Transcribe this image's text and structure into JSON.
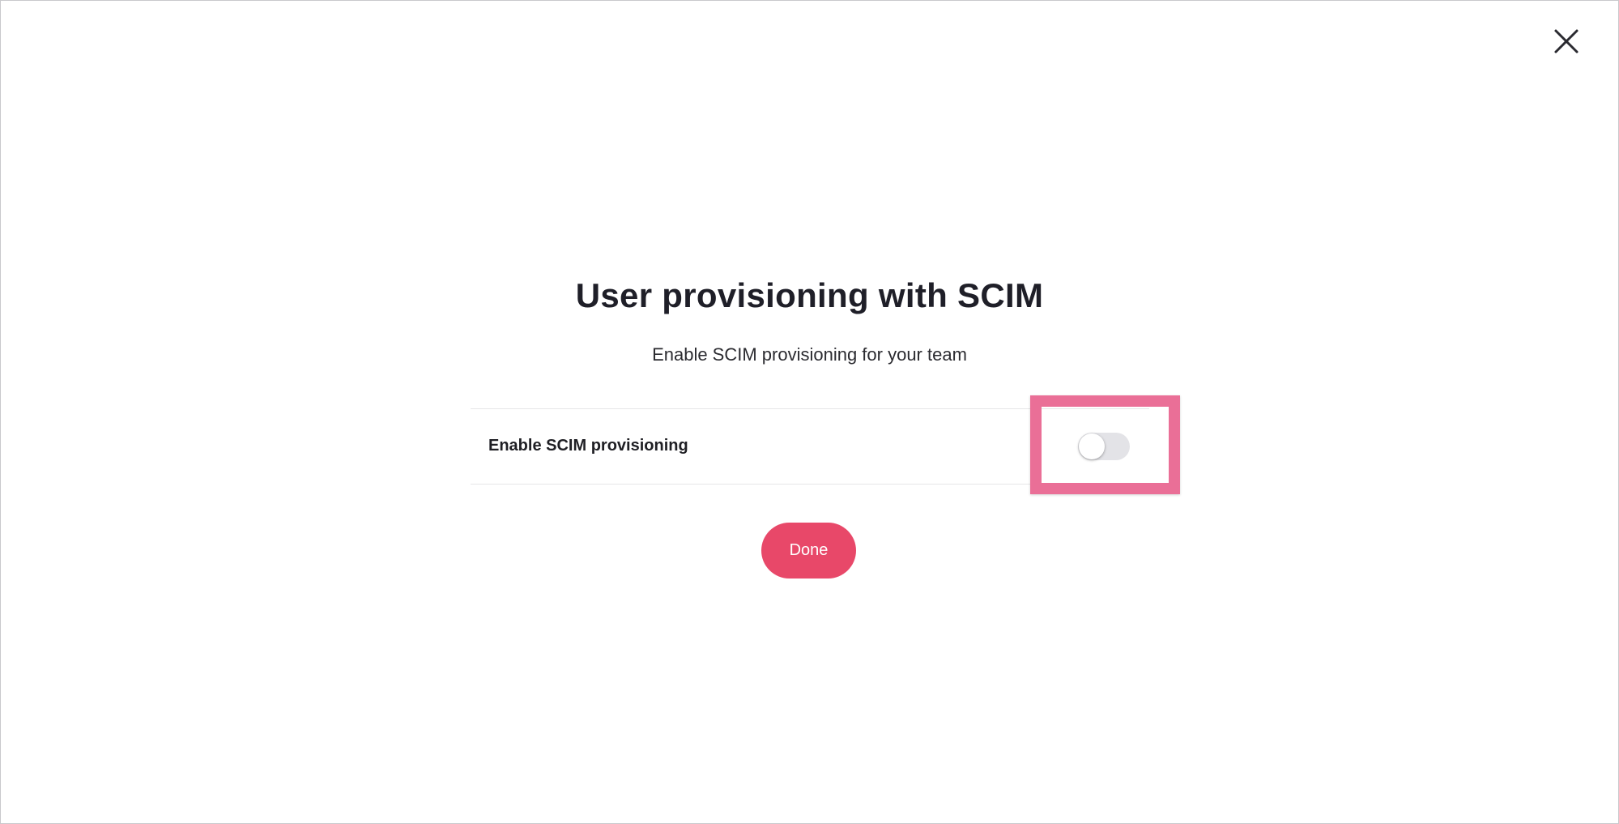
{
  "header": {
    "close_icon": "close-icon"
  },
  "dialog": {
    "title": "User provisioning with SCIM",
    "subtitle": "Enable SCIM provisioning for your team"
  },
  "settings": {
    "scim_label": "Enable SCIM provisioning",
    "scim_enabled": false,
    "scim_highlighted": true
  },
  "actions": {
    "done_label": "Done"
  },
  "colors": {
    "primary": "#e84869",
    "highlight": "#ea6f97",
    "toggle_off_track": "#e3e3e7",
    "text": "#1f1f28"
  }
}
